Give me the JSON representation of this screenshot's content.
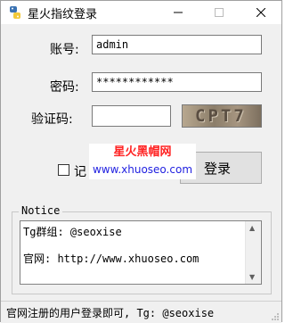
{
  "window": {
    "title": "星火指纹登录"
  },
  "form": {
    "account_label": "账号:",
    "account_value": "admin",
    "password_label": "密码:",
    "password_value": "************",
    "captcha_label": "验证码:",
    "captcha_value": "",
    "captcha_image_text": "CPT7",
    "remember_label": "记",
    "remember_checked": false,
    "login_button": "登录"
  },
  "watermark": {
    "line1": "星火黑帽网",
    "line2": "www.xhuoseo.com"
  },
  "notice": {
    "title": "Notice",
    "lines": [
      "Tg群组: @seoxise",
      "官网: http://www.xhuoseo.com"
    ]
  },
  "status": {
    "text": "官网注册的用户登录即可, Tg: @seoxise"
  },
  "colors": {
    "watermark_red": "#ff2222",
    "watermark_blue": "#1f1fe0"
  }
}
